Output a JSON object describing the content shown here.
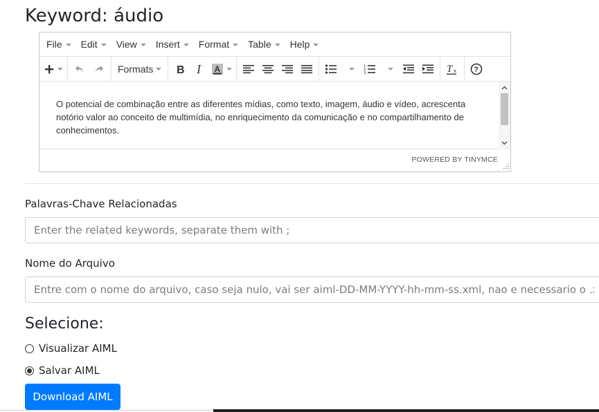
{
  "page": {
    "title": "Keyword: áudio"
  },
  "editor": {
    "menu": [
      "File",
      "Edit",
      "View",
      "Insert",
      "Format",
      "Table",
      "Help"
    ],
    "toolbar": {
      "formats_label": "Formats",
      "icons": [
        "plus-icon",
        "undo-icon",
        "redo-icon",
        "bold-icon",
        "italic-icon",
        "text-color-icon",
        "align-left-icon",
        "align-center-icon",
        "align-right-icon",
        "align-justify-icon",
        "bullet-list-icon",
        "numbered-list-icon",
        "outdent-icon",
        "indent-icon",
        "clear-formatting-icon",
        "help-icon"
      ]
    },
    "content": "O potencial de combinação entre as diferentes mídias, como texto, imagem, áudio e vídeo, acrescenta notório valor ao conceito de multimídia, no enriquecimento da comunicação e no compartilhamento de conhecimentos.",
    "powered_by": "POWERED BY TINYMCE"
  },
  "form": {
    "related_label": "Palavras-Chave Relacionadas",
    "related_placeholder": "Enter the related keywords, separate them with ;",
    "filename_label": "Nome do Arquivo",
    "filename_placeholder": "Entre com o nome do arquivo, caso seja nulo, vai ser aiml-DD-MM-YYYY-hh-mm-ss.xml, nao e necessario o .xml",
    "select_title": "Selecione:",
    "options": [
      {
        "label": "Visualizar AIML",
        "checked": false
      },
      {
        "label": "Salvar AIML",
        "checked": true
      }
    ],
    "download_label": "Download AIML"
  },
  "colors": {
    "primary": "#007bff",
    "border": "#ced4da"
  }
}
